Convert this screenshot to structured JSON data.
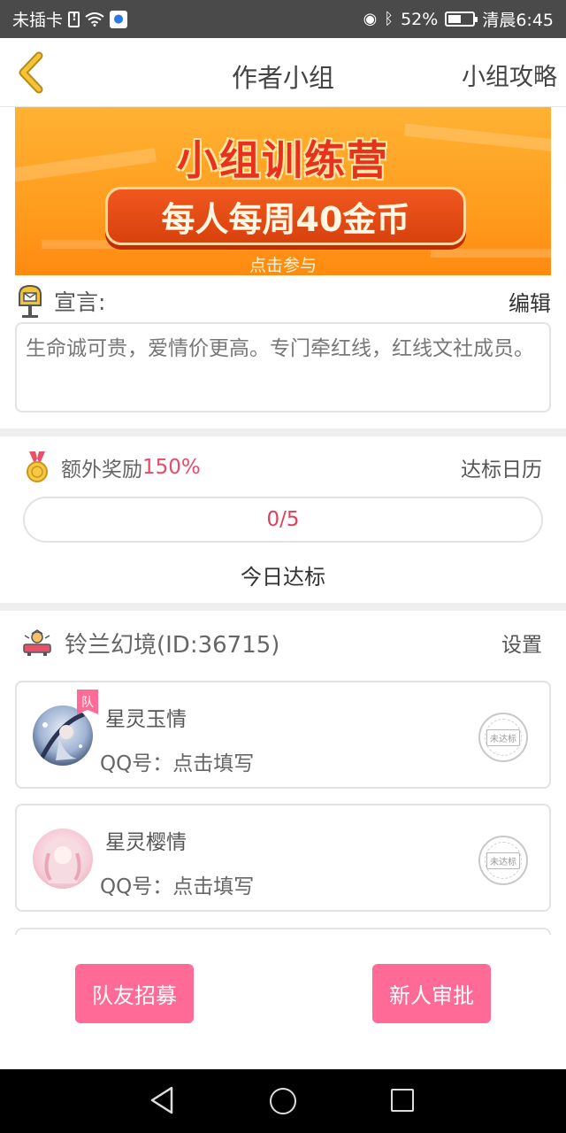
{
  "status_bar": {
    "carrier": "未插卡",
    "battery": "52%",
    "battery_level": 0.52,
    "time": "清晨6:45"
  },
  "header": {
    "title": "作者小组",
    "right_link": "小组攻略"
  },
  "banner": {
    "title": "小组训练营",
    "subtitle": "每人每周40金币",
    "cta": "点击参与"
  },
  "declaration": {
    "label": "宣言:",
    "edit": "编辑",
    "text": "生命诚可贵，爱情价更高。专门牵红线，红线文社成员。"
  },
  "reward": {
    "label": "额外奖励",
    "value": "150%",
    "calendar": "达标日历",
    "progress_text": "0/5",
    "progress_fraction": 0,
    "today_label": "今日达标"
  },
  "group": {
    "name": "铃兰幻境(ID:36715)",
    "settings": "设置"
  },
  "members": [
    {
      "name": "星灵玉情",
      "qq_label": "QQ号：",
      "qq_prompt": "点击填写",
      "badge": "队",
      "stamp": "未达标"
    },
    {
      "name": "星灵樱情",
      "qq_label": "QQ号：",
      "qq_prompt": "点击填写",
      "stamp": "未达标"
    }
  ],
  "actions": {
    "recruit": "队友招募",
    "approve": "新人审批"
  },
  "colors": {
    "accent_pink": "#ff6b96",
    "highlight_red": "#e84a6a",
    "banner_orange": "#ff9d1f"
  },
  "icons": {
    "back": "chevron-left-icon",
    "declaration": "mailbox-icon",
    "reward": "medal-icon",
    "group": "group-leader-icon"
  }
}
